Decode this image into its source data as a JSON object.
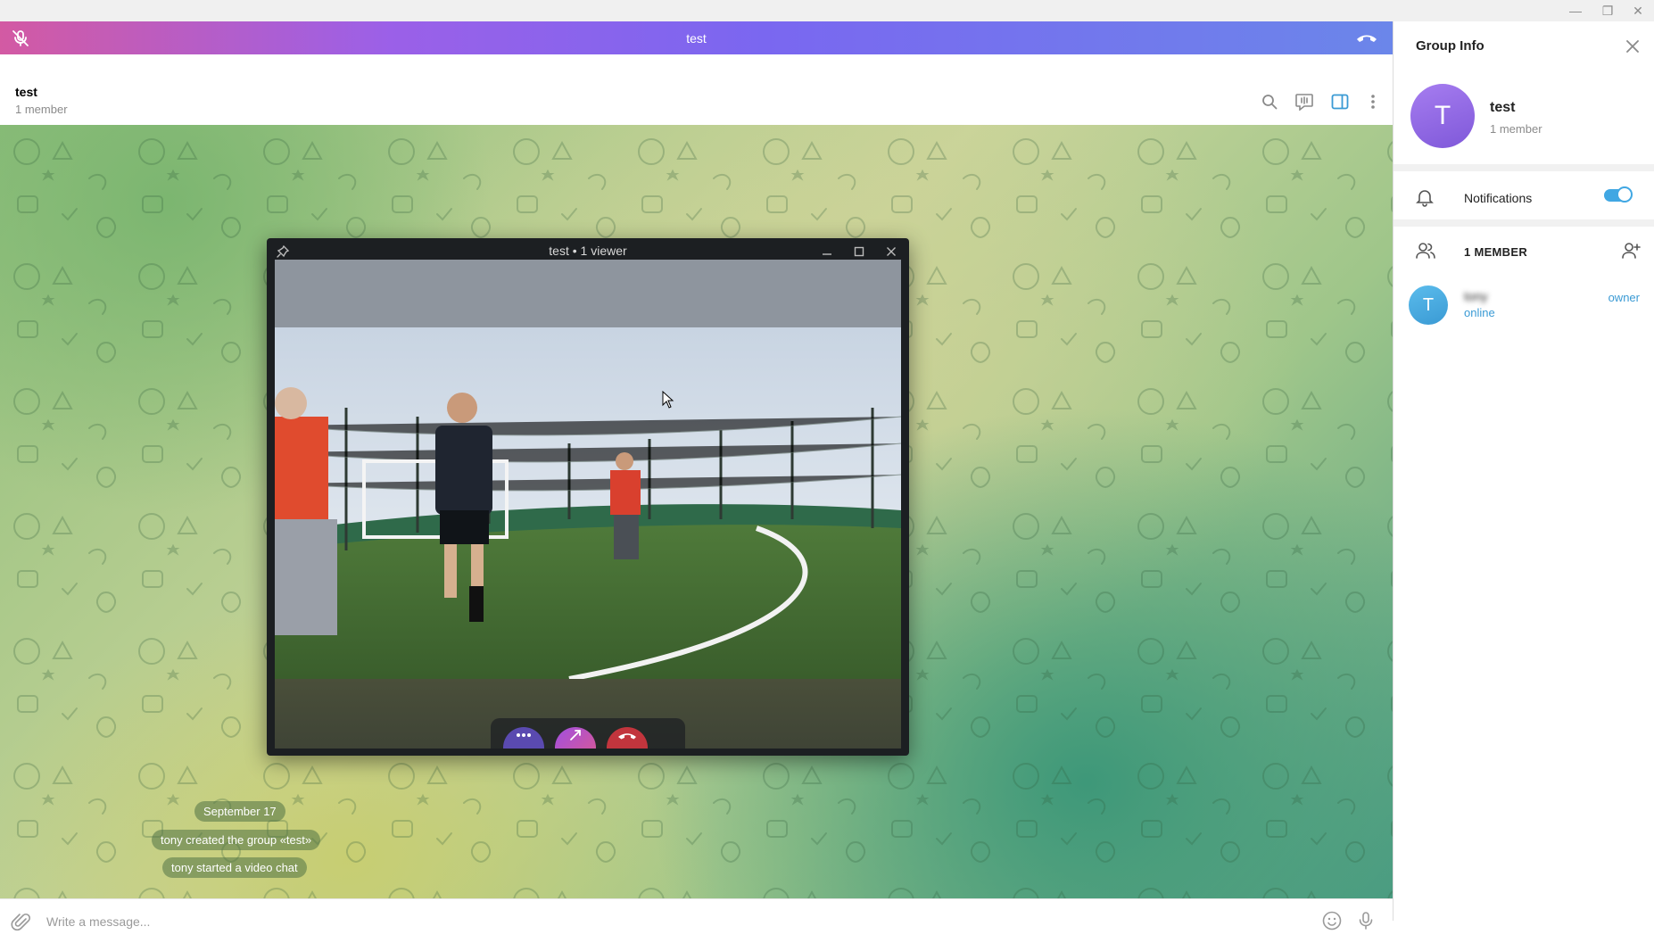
{
  "window": {
    "minimize": "—",
    "restore": "❐",
    "close": "✕"
  },
  "call_bar": {
    "title": "test"
  },
  "chat_header": {
    "title": "test",
    "subtitle": "1 member"
  },
  "service_messages": {
    "date": "September 17",
    "created": "tony created the group «test»",
    "started": "tony started a video chat"
  },
  "composer": {
    "placeholder": "Write a message..."
  },
  "video_window": {
    "title": "test • 1 viewer"
  },
  "group_info": {
    "title": "Group Info",
    "name": "test",
    "avatar_letter": "T",
    "member_count": "1 member",
    "notifications_label": "Notifications",
    "notifications_on": true,
    "members_label": "1 MEMBER",
    "members": [
      {
        "avatar_letter": "T",
        "name": "tony",
        "status": "online",
        "role": "owner"
      }
    ]
  },
  "colors": {
    "accent": "#40a7e3",
    "call_bar_start": "#d35aa3",
    "call_bar_end": "#6b86ea",
    "hangup_red": "#d9363e"
  }
}
